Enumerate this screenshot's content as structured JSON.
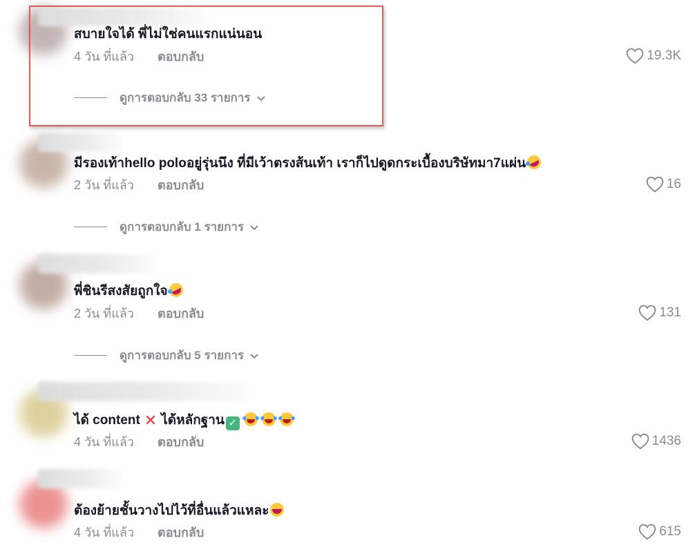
{
  "comments": [
    {
      "text": "สบายใจได้ พี่ไม่ใช่คนแรกแน่นอน",
      "time": "4 วัน ที่แล้ว",
      "reply_label": "ตอบกลับ",
      "likes": "19.3K",
      "view_replies": "ดูการตอบกลับ 33 รายการ"
    },
    {
      "text": "มีรองเท้าhello poloอยู่รุ่นนึง ที่มีเว้าตรงส้นเท้า เราก็ไปดูดกระเบื้องบริษัทมา7แผ่น",
      "time": "2 วัน ที่แล้ว",
      "reply_label": "ตอบกลับ",
      "likes": "16",
      "view_replies": "ดูการตอบกลับ 1 รายการ"
    },
    {
      "text": "พี่ชินรีสงสัยถูกใจ",
      "time": "2 วัน ที่แล้ว",
      "reply_label": "ตอบกลับ",
      "likes": "131",
      "view_replies": "ดูการตอบกลับ 5 รายการ"
    },
    {
      "text_part1": "ได้ content",
      "text_part2": "ได้หลักฐาน",
      "time": "4 วัน ที่แล้ว",
      "reply_label": "ตอบกลับ",
      "likes": "1436"
    },
    {
      "text": "ต้องย้ายชั้นวางไปไว้ที่อื่นแล้วแหละ",
      "time": "4 วัน ที่แล้ว",
      "reply_label": "ตอบกลับ",
      "likes": "615"
    }
  ],
  "icons": {
    "like": "heart-outline-icon",
    "expand": "chevron-down-icon",
    "emoji_rofl": "rolling-on-floor-laughing-emoji",
    "emoji_joy": "tears-of-joy-emoji",
    "emoji_grin": "grinning-squinting-emoji",
    "cross": "cross-mark-emoji",
    "check": "check-mark-button-emoji"
  },
  "colors": {
    "highlight_border": "#e05a5a",
    "secondary_text": "#8a8b91",
    "primary_text": "#161823"
  }
}
